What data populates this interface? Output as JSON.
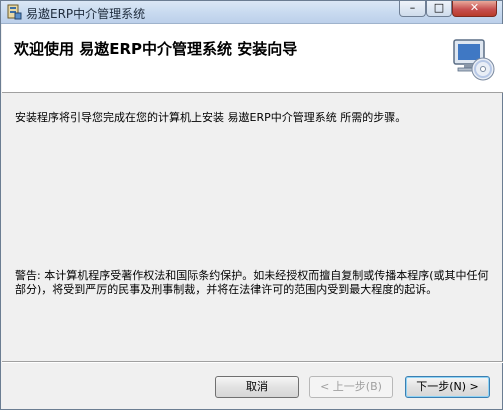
{
  "window": {
    "title": "易遨ERP中介管理系统",
    "controls": {
      "minimize": "–",
      "maximize": "□",
      "close": "✕"
    }
  },
  "header": {
    "title": "欢迎使用 易遨ERP中介管理系统 安装向导",
    "graphic_icon": "computer-disc-icon"
  },
  "main": {
    "intro": "安装程序将引导您完成在您的计算机上安装 易遨ERP中介管理系统 所需的步骤。",
    "warning": "警告: 本计算机程序受著作权法和国际条约保护。如未经授权而擅自复制或传播本程序(或其中任何部分)，将受到严厉的民事及刑事制裁，并将在法律许可的范围内受到最大程度的起诉。"
  },
  "buttons": {
    "cancel": "取消",
    "back": "< 上一步(B)",
    "next": "下一步(N) >"
  },
  "colors": {
    "accent": "#3c7fb1",
    "close": "#c75050"
  }
}
